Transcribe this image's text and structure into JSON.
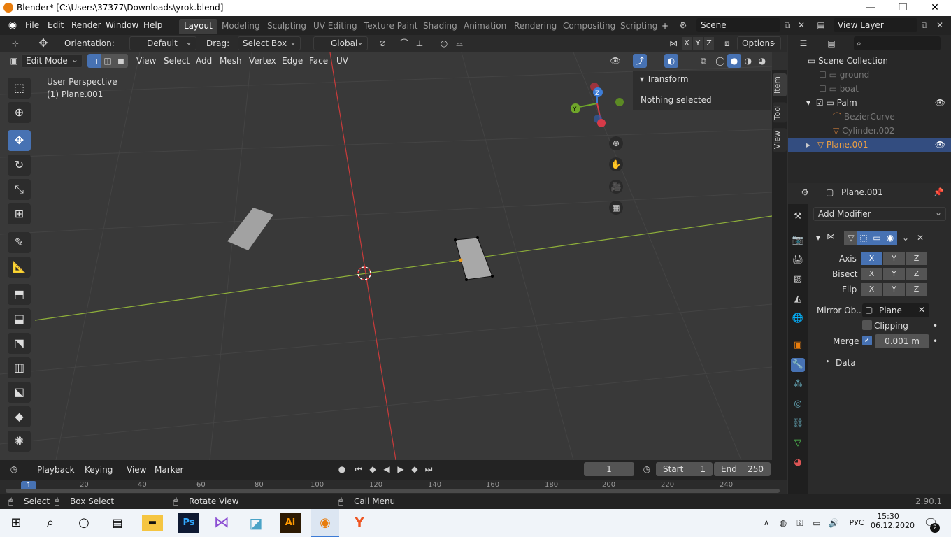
{
  "window": {
    "title": "Blender* [C:\\Users\\37377\\Downloads\\yrok.blend]",
    "min": "—",
    "max": "❐",
    "close": "✕"
  },
  "menus": [
    "File",
    "Edit",
    "Render",
    "Window",
    "Help"
  ],
  "workspaces": [
    "Layout",
    "Modeling",
    "Sculpting",
    "UV Editing",
    "Texture Paint",
    "Shading",
    "Animation",
    "Rendering",
    "Compositing",
    "Scripting"
  ],
  "scene": {
    "name": "Scene",
    "view_layer": "View Layer"
  },
  "tool_header": {
    "orientation_label": "Orientation:",
    "orientation_value": "Default",
    "drag_label": "Drag:",
    "drag_value": "Select Box",
    "transform_space": "Global",
    "axes": [
      "X",
      "Y",
      "Z"
    ],
    "options": "Options"
  },
  "viewport_header": {
    "mode": "Edit Mode",
    "menus": [
      "View",
      "Select",
      "Add",
      "Mesh",
      "Vertex",
      "Edge",
      "Face",
      "UV"
    ]
  },
  "viewport": {
    "perspective": "User Perspective",
    "object": "(1) Plane.001",
    "gizmo_x": "X",
    "gizmo_y": "Y",
    "gizmo_z": "Z"
  },
  "npanel": {
    "header": "Transform",
    "message": "Nothing selected",
    "tabs": [
      "Item",
      "Tool",
      "View"
    ]
  },
  "outliner": {
    "root": "Scene Collection",
    "items": [
      {
        "name": "ground"
      },
      {
        "name": "boat"
      },
      {
        "name": "Palm"
      },
      {
        "name": "BezierCurve"
      },
      {
        "name": "Cylinder.002"
      },
      {
        "name": "Plane.001"
      }
    ]
  },
  "properties": {
    "object": "Plane.001",
    "add_modifier": "Add Modifier",
    "axis_label": "Axis",
    "bisect_label": "Bisect",
    "flip_label": "Flip",
    "xyz": [
      "X",
      "Y",
      "Z"
    ],
    "mirror_object_label": "Mirror Ob...",
    "mirror_object_value": "Plane",
    "clipping_label": "Clipping",
    "merge_label": "Merge",
    "merge_value": "0.001 m",
    "data_label": "Data"
  },
  "timeline": {
    "menus": [
      "Playback",
      "Keying",
      "View",
      "Marker"
    ],
    "current_frame": "1",
    "start_label": "Start",
    "start_value": "1",
    "end_label": "End",
    "end_value": "250",
    "ruler": [
      "1",
      "20",
      "40",
      "60",
      "80",
      "100",
      "120",
      "140",
      "160",
      "180",
      "200",
      "220",
      "240"
    ]
  },
  "statusbar": {
    "select": "Select",
    "box_select": "Box Select",
    "rotate": "Rotate View",
    "call_menu": "Call Menu",
    "version": "2.90.1"
  },
  "taskbar": {
    "time": "15:30",
    "date": "06.12.2020",
    "lang": "РУС",
    "notif_count": "2",
    "ai": "Ai",
    "ps": "Ps"
  }
}
